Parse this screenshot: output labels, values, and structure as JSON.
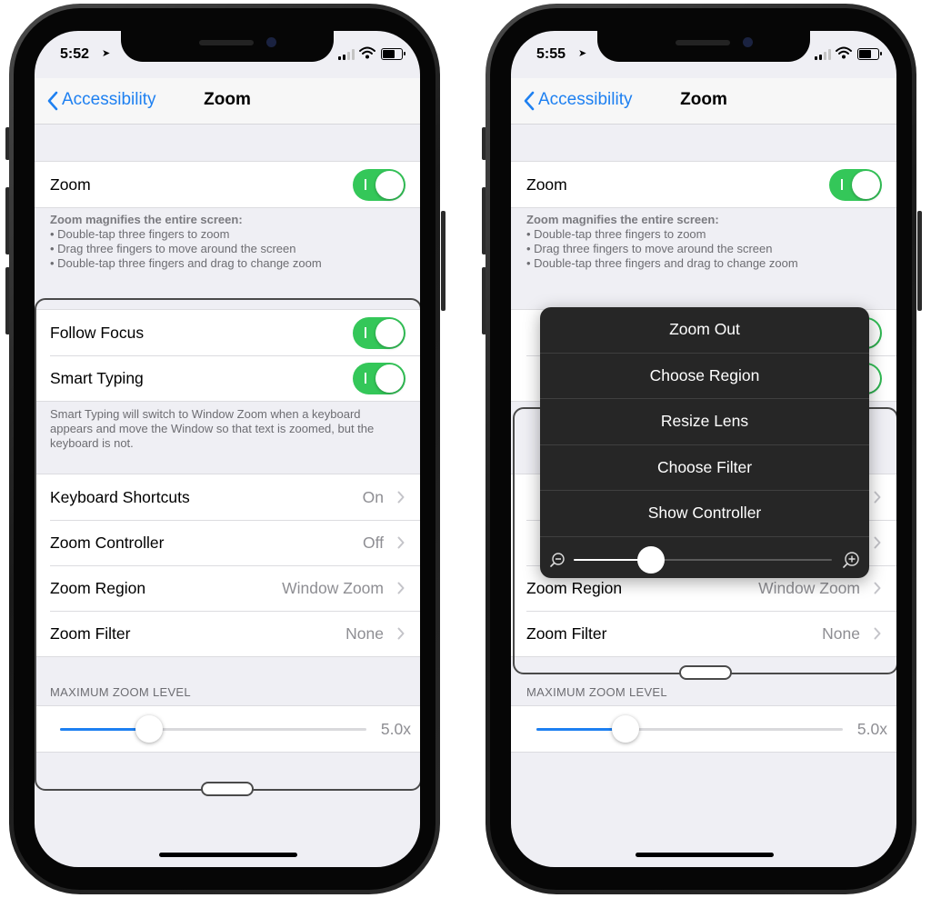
{
  "colors": {
    "accent": "#1e80f1",
    "toggle_on": "#34c759",
    "popup_bg": "#262626"
  },
  "phones": [
    {
      "status": {
        "time": "5:52",
        "location_icon": "location-arrow-icon",
        "signal_icon": "cellular-signal-icon",
        "wifi_icon": "wifi-icon",
        "battery_icon": "battery-icon"
      },
      "nav": {
        "back_label": "Accessibility",
        "title": "Zoom",
        "back_icon": "chevron-left-icon"
      },
      "zoom_row": {
        "label": "Zoom",
        "toggle_on": true
      },
      "zoom_footer": {
        "heading": "Zoom magnifies the entire screen:",
        "items": [
          "•  Double-tap three fingers to zoom",
          "•  Drag three fingers to move around the screen",
          "•  Double-tap three fingers and drag to change zoom"
        ]
      },
      "follow_focus": {
        "label": "Follow Focus",
        "toggle_on": true
      },
      "smart_typing": {
        "label": "Smart Typing",
        "toggle_on": true
      },
      "smart_footer": "Smart Typing will switch to Window Zoom when a keyboard appears and move the Window so that text is zoomed, but the keyboard is not.",
      "settings": [
        {
          "label": "Keyboard Shortcuts",
          "value": "On"
        },
        {
          "label": "Zoom Controller",
          "value": "Off"
        },
        {
          "label": "Zoom Region",
          "value": "Window Zoom"
        },
        {
          "label": "Zoom Filter",
          "value": "None"
        }
      ],
      "max_zoom": {
        "header": "MAXIMUM ZOOM LEVEL",
        "value": "5.0x",
        "level_fraction": 0.29
      }
    },
    {
      "status": {
        "time": "5:55",
        "location_icon": "location-arrow-icon",
        "signal_icon": "cellular-signal-icon",
        "wifi_icon": "wifi-icon",
        "battery_icon": "battery-icon"
      },
      "nav": {
        "back_label": "Accessibility",
        "title": "Zoom",
        "back_icon": "chevron-left-icon"
      },
      "zoom_row": {
        "label": "Zoom",
        "toggle_on": true
      },
      "zoom_footer": {
        "heading": "Zoom magnifies the entire screen:",
        "items": [
          "•  Double-tap three fingers to zoom",
          "•  Drag three fingers to move around the screen",
          "•  Double-tap three fingers and drag to change zoom"
        ]
      },
      "settings": [
        {
          "label": "Zoom Region",
          "value": "Window Zoom"
        },
        {
          "label": "Zoom Filter",
          "value": "None"
        }
      ],
      "max_zoom": {
        "header": "MAXIMUM ZOOM LEVEL",
        "value": "5.0x",
        "level_fraction": 0.29
      },
      "popup": {
        "items": [
          "Zoom Out",
          "Choose Region",
          "Resize Lens",
          "Choose Filter",
          "Show Controller"
        ],
        "zoom_level_fraction": 0.3,
        "zoom_out_icon": "zoom-out-icon",
        "zoom_in_icon": "zoom-in-icon"
      }
    }
  ]
}
